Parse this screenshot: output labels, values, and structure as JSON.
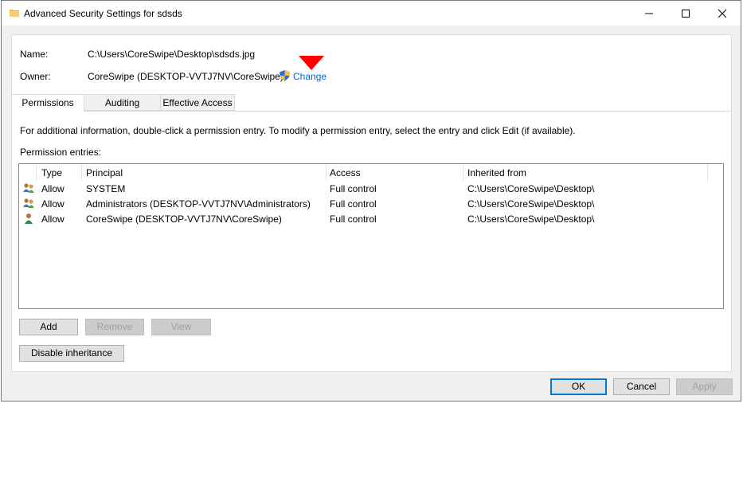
{
  "window": {
    "title": "Advanced Security Settings for sdsds"
  },
  "info": {
    "name_label": "Name:",
    "name_value": "C:\\Users\\CoreSwipe\\Desktop\\sdsds.jpg",
    "owner_label": "Owner:",
    "owner_value": "CoreSwipe (DESKTOP-VVTJ7NV\\CoreSwipe)",
    "change_link": "Change"
  },
  "tabs": [
    {
      "label": "Permissions",
      "active": true
    },
    {
      "label": "Auditing",
      "active": false
    },
    {
      "label": "Effective Access",
      "active": false
    }
  ],
  "permissions": {
    "info_text": "For additional information, double-click a permission entry. To modify a permission entry, select the entry and click Edit (if available).",
    "entries_label": "Permission entries:",
    "columns": [
      "Type",
      "Principal",
      "Access",
      "Inherited from"
    ],
    "rows": [
      {
        "icon": "group-users-icon",
        "type": "Allow",
        "principal": "SYSTEM",
        "access": "Full control",
        "inherited": "C:\\Users\\CoreSwipe\\Desktop\\"
      },
      {
        "icon": "group-users-icon",
        "type": "Allow",
        "principal": "Administrators (DESKTOP-VVTJ7NV\\Administrators)",
        "access": "Full control",
        "inherited": "C:\\Users\\CoreSwipe\\Desktop\\"
      },
      {
        "icon": "user-icon",
        "type": "Allow",
        "principal": "CoreSwipe (DESKTOP-VVTJ7NV\\CoreSwipe)",
        "access": "Full control",
        "inherited": "C:\\Users\\CoreSwipe\\Desktop\\"
      }
    ],
    "buttons": {
      "add": "Add",
      "remove": "Remove",
      "view": "View",
      "disable_inheritance": "Disable inheritance"
    }
  },
  "footer": {
    "ok": "OK",
    "cancel": "Cancel",
    "apply": "Apply"
  },
  "colors": {
    "link": "#0066cc",
    "marker": "#ff0000",
    "default_button_border": "#0078d7"
  }
}
